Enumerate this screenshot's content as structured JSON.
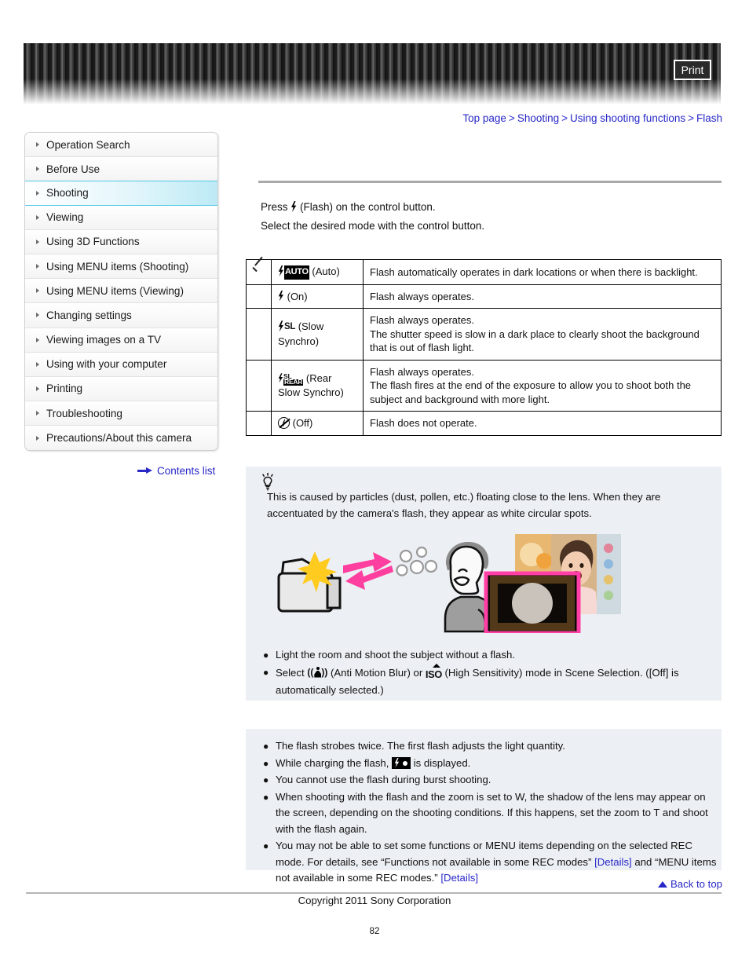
{
  "header": {
    "print_label": "Print"
  },
  "breadcrumb": {
    "items": [
      "Top page",
      "Shooting",
      "Using shooting functions",
      "Flash"
    ],
    "separator": ">"
  },
  "sidebar": {
    "items": [
      {
        "label": "Operation Search",
        "active": false
      },
      {
        "label": "Before Use",
        "active": false
      },
      {
        "label": "Shooting",
        "active": true
      },
      {
        "label": "Viewing",
        "active": false
      },
      {
        "label": "Using 3D Functions",
        "active": false
      },
      {
        "label": "Using MENU items (Shooting)",
        "active": false
      },
      {
        "label": "Using MENU items (Viewing)",
        "active": false
      },
      {
        "label": "Changing settings",
        "active": false
      },
      {
        "label": "Viewing images on a TV",
        "active": false
      },
      {
        "label": "Using with your computer",
        "active": false
      },
      {
        "label": "Printing",
        "active": false
      },
      {
        "label": "Troubleshooting",
        "active": false
      },
      {
        "label": "Precautions/About this camera",
        "active": false
      }
    ],
    "contents_link": "Contents list"
  },
  "instructions": {
    "line1_before": "Press ",
    "line1_after": " (Flash) on the control button.",
    "line2": "Select the desired mode with the control button."
  },
  "mode_table": {
    "rows": [
      {
        "checked": true,
        "icon": "flash-auto-icon",
        "mode_suffix": " (Auto)",
        "description": "Flash automatically operates in dark locations or when there is backlight."
      },
      {
        "checked": false,
        "icon": "flash-on-icon",
        "mode_suffix": " (On)",
        "description": "Flash always operates."
      },
      {
        "checked": false,
        "icon": "flash-slow-synchro-icon",
        "mode_suffix": " (Slow Synchro)",
        "description": "Flash always operates.\nThe shutter speed is slow in a dark place to clearly shoot the background that is out of flash light."
      },
      {
        "checked": false,
        "icon": "flash-rear-slow-synchro-icon",
        "mode_suffix": " (Rear Slow Synchro)",
        "description": "Flash always operates.\nThe flash fires at the end of the exposure to allow you to shoot both the subject and background with more light."
      },
      {
        "checked": false,
        "icon": "flash-off-icon",
        "mode_suffix": " (Off)",
        "description": "Flash does not operate."
      }
    ],
    "auto_tag": "AUTO",
    "sl_tag": "SL",
    "rear_tag": "REAR"
  },
  "tip_box": {
    "paragraph": "This is caused by particles (dust, pollen, etc.) floating close to the lens. When they are accentuated by the camera's flash, they appear as white circular spots.",
    "bullets": [
      {
        "parts": [
          "Light the room and shoot the subject without a flash."
        ]
      },
      {
        "parts": [
          "Select ",
          "[anti-motion-blur-icon]",
          " (Anti Motion Blur) or ",
          "[iso-icon]",
          " (High Sensitivity) mode in Scene Selection. ([Off] is automatically selected.)"
        ],
        "text_a": "Select ",
        "text_b": " (Anti Motion Blur) or ",
        "text_c": " (High Sensitivity) mode in Scene Selection. ([Off] is automatically selected.)",
        "iso_label": "ISO"
      }
    ]
  },
  "note_box": {
    "bullets": [
      {
        "text": "The flash strobes twice. The first flash adjusts the light quantity."
      },
      {
        "text_a": "While charging the flash, ",
        "text_b": " is displayed."
      },
      {
        "text": "You cannot use the flash during burst shooting."
      },
      {
        "text": "When shooting with the flash and the zoom is set to W, the shadow of the lens may appear on the screen, depending on the shooting conditions. If this happens, set the zoom to T and shoot with the flash again."
      },
      {
        "text_a": "You may not be able to set some functions or MENU items depending on the selected REC mode. For details, see “Functions not available in some REC modes” ",
        "link1": "[Details]",
        "text_b": " and “MENU items not available in some REC modes.” ",
        "link2": "[Details]"
      }
    ]
  },
  "footer": {
    "back_to_top": "Back to top",
    "copyright": "Copyright 2011 Sony Corporation",
    "page_number": "82"
  },
  "colors": {
    "link_blue": "#2828c8",
    "accent_cyan": "#54c8e4",
    "infobox_bg": "#eceff3",
    "illustration_pink": "#ff3aa0",
    "illustration_yellow": "#ffcc22"
  }
}
